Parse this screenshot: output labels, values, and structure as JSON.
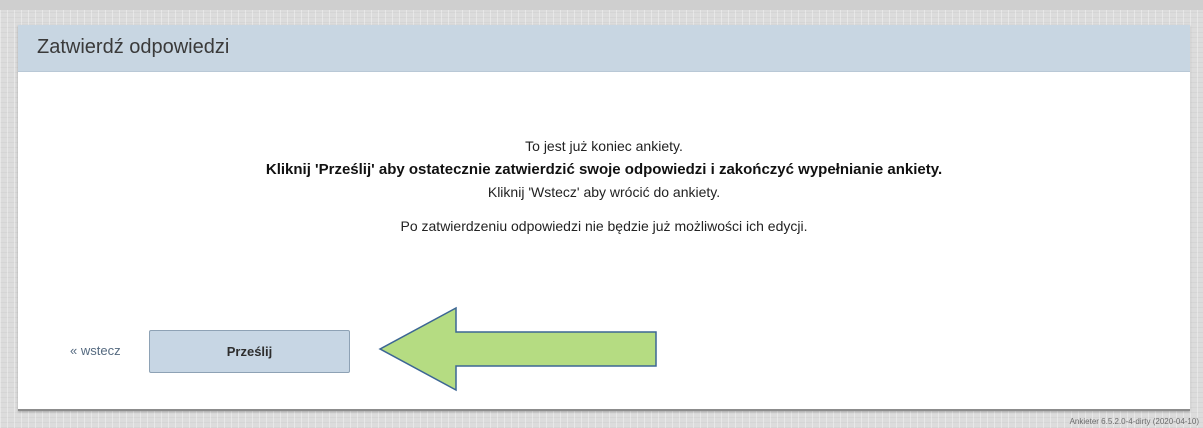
{
  "header": {
    "title": "Zatwierdź odpowiedzi"
  },
  "message": {
    "line1": "To jest już koniec ankiety.",
    "line2": "Kliknij 'Prześlij' aby ostatecznie zatwierdzić swoje odpowiedzi i zakończyć wypełnianie ankiety.",
    "line3": "Kliknij 'Wstecz' aby wrócić do ankiety.",
    "line4": "Po zatwierdzeniu odpowiedzi nie będzie już możliwości ich edycji."
  },
  "actions": {
    "back_label": "« wstecz",
    "submit_label": "Prześlij"
  },
  "annotation": {
    "icon": "arrow-left-icon",
    "fill_color": "#b5dc82",
    "stroke_color": "#3c6694"
  },
  "footer": {
    "version": "Ankieter 6.5.2.0-4-dirty (2020-04-10)"
  },
  "colors": {
    "header_bg": "#c8d6e2",
    "button_bg": "#c7d6e4",
    "link": "#556a80"
  }
}
